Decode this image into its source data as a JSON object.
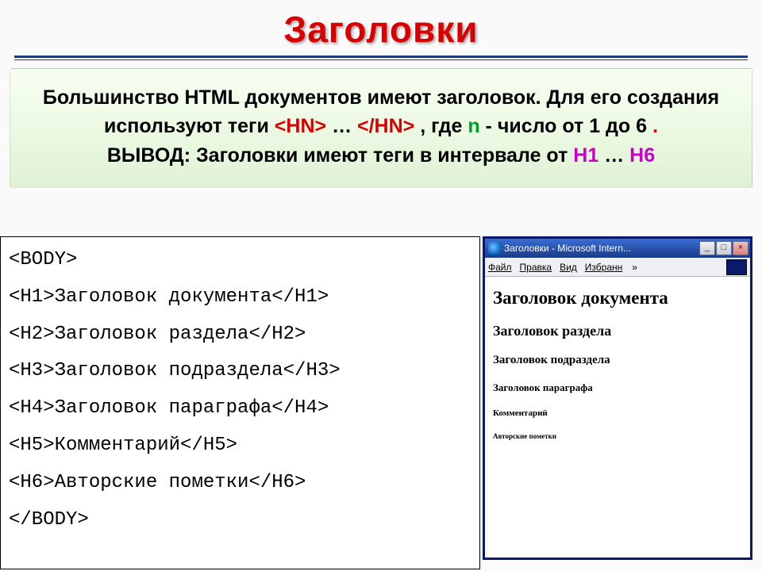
{
  "page_title": "Заголовки",
  "intro": {
    "line1_a": "Большинство HTML документов имеют заголовок. Для его создания используют теги ",
    "tag_open": "<HN>",
    "line1_b": "…",
    "tag_close": "</HN>",
    "line1_c": ", где ",
    "n_letter": "n",
    "line1_d": " - число от 1 до 6",
    "dot": ".",
    "line2_a": "ВЫВОД: Заголовки имеют теги в интервале от ",
    "h1": "H1",
    "line2_b": " … ",
    "h6": "H6"
  },
  "code_lines": {
    "l0": "<BODY>",
    "l1": "<H1>Заголовок документа</H1>",
    "l2": "<H2>Заголовок раздела</H2>",
    "l3": "<H3>Заголовок подраздела</H3>",
    "l4": "<H4>Заголовок параграфа</H4>",
    "l5": "<H5>Комментарий</H5>",
    "l6": "<H6>Авторские пометки</H6>",
    "l7": "</BODY>"
  },
  "browser": {
    "title": "Заголовки - Microsoft Intern...",
    "menu": {
      "file": "Файл",
      "edit": "Правка",
      "view": "Вид",
      "fav": "Избранн",
      "more": "»"
    },
    "buttons": {
      "min": "_",
      "max": "□",
      "close": "×"
    },
    "content": {
      "h1": "Заголовок документа",
      "h2": "Заголовок раздела",
      "h3": "Заголовок подраздела",
      "h4": "Заголовок параграфа",
      "h5": "Комментарий",
      "h6": "Авторские пометки"
    }
  }
}
